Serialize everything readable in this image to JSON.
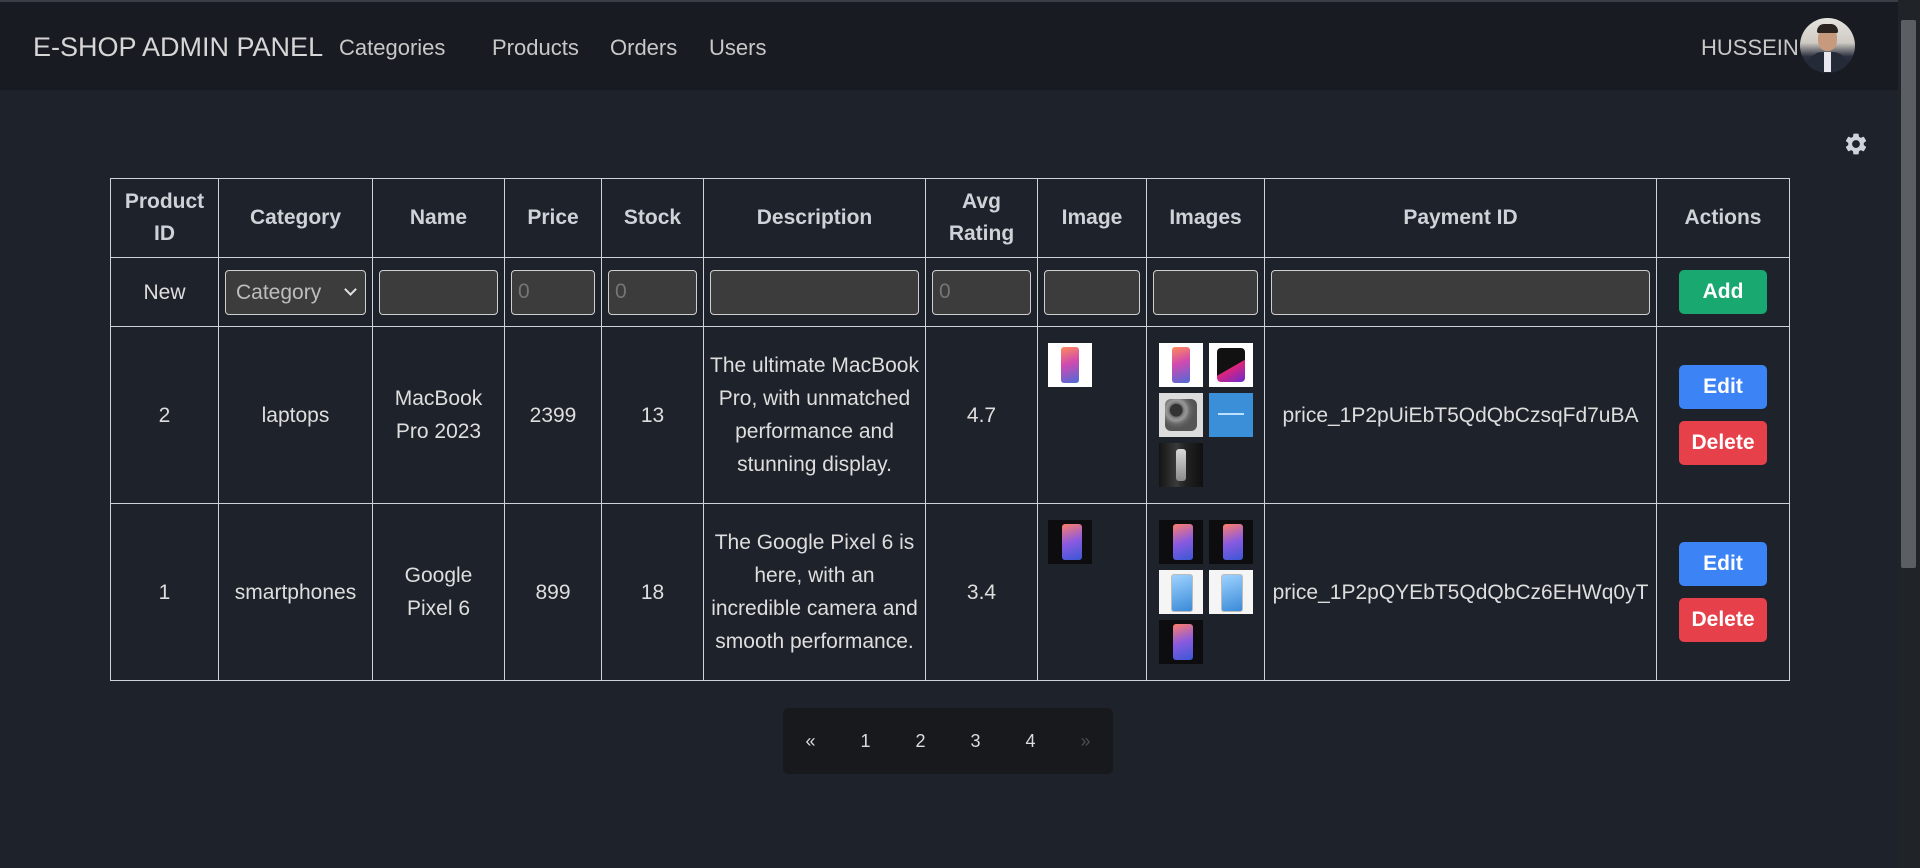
{
  "navbar": {
    "brand": "E-SHOP ADMIN PANEL",
    "links": [
      "Categories",
      "Products",
      "Orders",
      "Users"
    ],
    "username": "HUSSEIN"
  },
  "table": {
    "headers": [
      "Product ID",
      "Category",
      "Name",
      "Price",
      "Stock",
      "Description",
      "Avg Rating",
      "Image",
      "Images",
      "Payment ID",
      "Actions"
    ],
    "new_row": {
      "label": "New",
      "category_placeholder": "Category",
      "name_value": "",
      "price_placeholder": "0",
      "stock_placeholder": "0",
      "description_value": "",
      "rating_placeholder": "0",
      "image_value": "",
      "images_value": "",
      "payment_value": "",
      "add_label": "Add"
    },
    "rows": [
      {
        "id": "2",
        "category": "laptops",
        "name": "MacBook Pro 2023",
        "price": "2399",
        "stock": "13",
        "description": "The ultimate MacBook Pro, with unmatched performance and stunning display.",
        "rating": "4.7",
        "payment_id": "price_1P2pUiEbT5QdQbCzsqFd7uBA",
        "edit_label": "Edit",
        "delete_label": "Delete"
      },
      {
        "id": "1",
        "category": "smartphones",
        "name": "Google Pixel 6",
        "price": "899",
        "stock": "18",
        "description": "The Google Pixel 6 is here, with an incredible camera and smooth performance.",
        "rating": "3.4",
        "payment_id": "price_1P2pQYEbT5QdQbCz6EHWq0yT",
        "edit_label": "Edit",
        "delete_label": "Delete"
      }
    ]
  },
  "pagination": {
    "prev": "«",
    "pages": [
      "1",
      "2",
      "3",
      "4"
    ],
    "next": "»"
  },
  "icons": {
    "settings": "gear-icon",
    "avatar": "user-avatar"
  },
  "colors": {
    "background": "#1e222a",
    "navbar": "#181b21",
    "add_button": "#1aa871",
    "edit_button": "#3c83f6",
    "delete_button": "#e6414b"
  }
}
